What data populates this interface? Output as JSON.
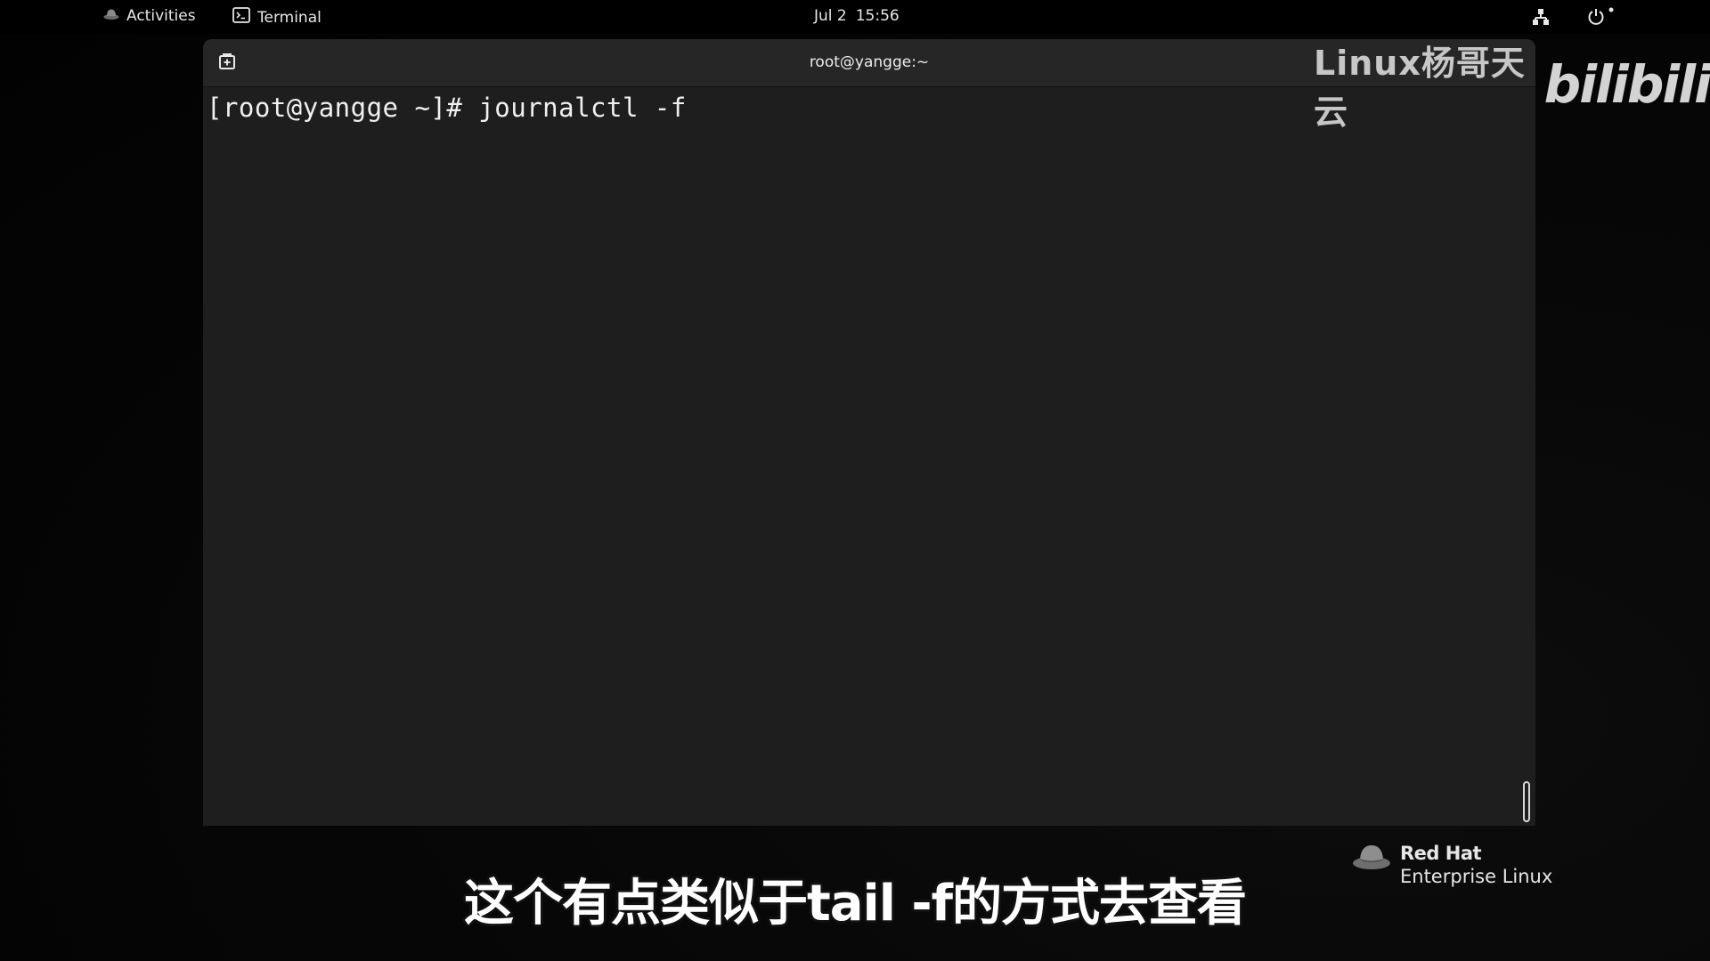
{
  "topbar": {
    "activities_label": "Activities",
    "app_label": "Terminal",
    "date": "Jul 2",
    "time": "15:56",
    "icons": [
      "redhat-icon",
      "terminal-icon",
      "network-icon",
      "power-icon"
    ]
  },
  "terminal": {
    "title": "root@yangge:~",
    "prompt_line": "[root@yangge ~]# journalctl -f",
    "background": "#1e1e1e",
    "header_background": "#262626"
  },
  "watermark": {
    "text": "Linux杨哥天云",
    "logo_text": "bilibili"
  },
  "redhat_logo": {
    "brand": "Red Hat",
    "product": "Enterprise Linux"
  },
  "subtitle": {
    "text": "这个有点类似于tail -f的方式去查看"
  }
}
